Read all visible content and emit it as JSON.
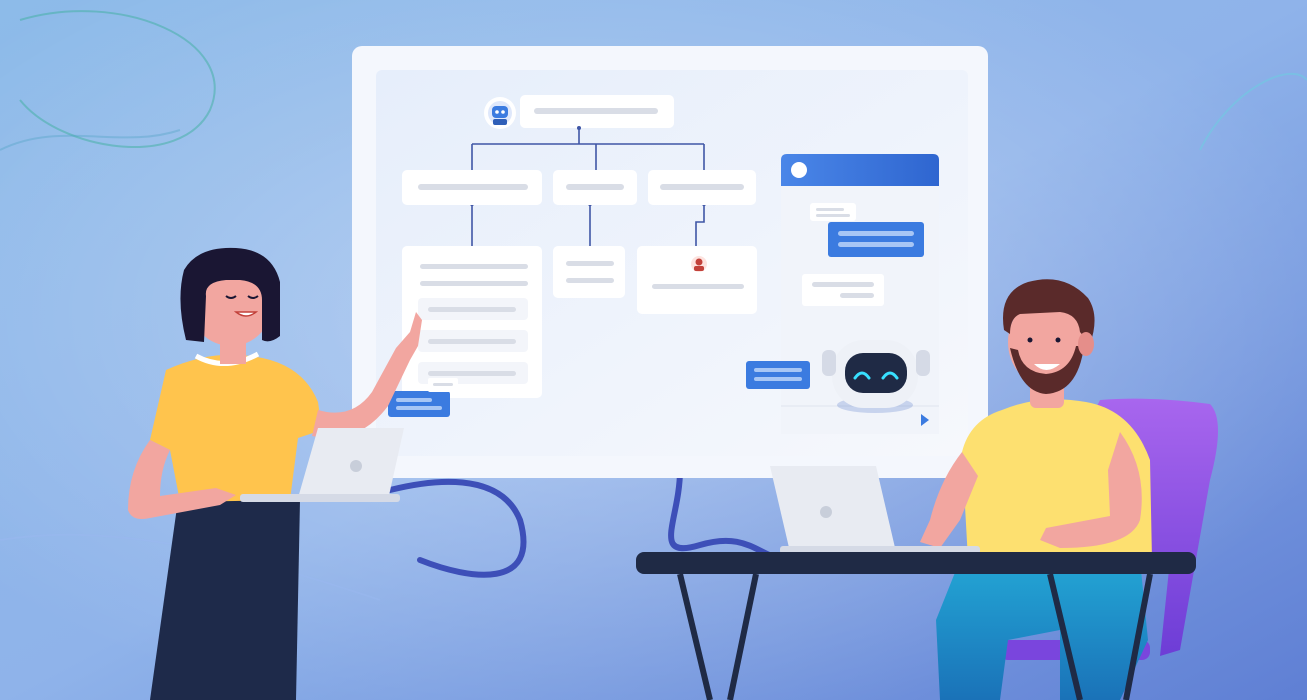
{
  "scene": {
    "description_free": true,
    "colors": {
      "bg_top": "#8fb8ec",
      "bg_mid": "#7aa9e6",
      "bg_bottom": "#5f86d6",
      "board": "#f4f7fd",
      "board_inner": "#dfe9fa",
      "node": "#ffffff",
      "line": "#3f56a6",
      "bubble_blue": "#3b7be0",
      "shirt_yellow": "#ffc44d",
      "pants_dark": "#1e2a4a",
      "skin": "#f2a6a0",
      "hair_dark": "#1a1633",
      "man_hair": "#5a2a2a",
      "chair_purple": "#9b59e6",
      "jeans": "#1f9ac9",
      "laptop": "#e8ebf2",
      "table_top": "#1f2a45",
      "robot_body": "#eef1f7",
      "robot_face": "#1f2a45",
      "robot_eye": "#38e0ff"
    },
    "icons": {
      "bot": "robot-avatar-icon",
      "user": "user-avatar-icon",
      "send": "send-triangle-icon",
      "chat_avatar": "chat-avatar-circle-icon"
    }
  }
}
